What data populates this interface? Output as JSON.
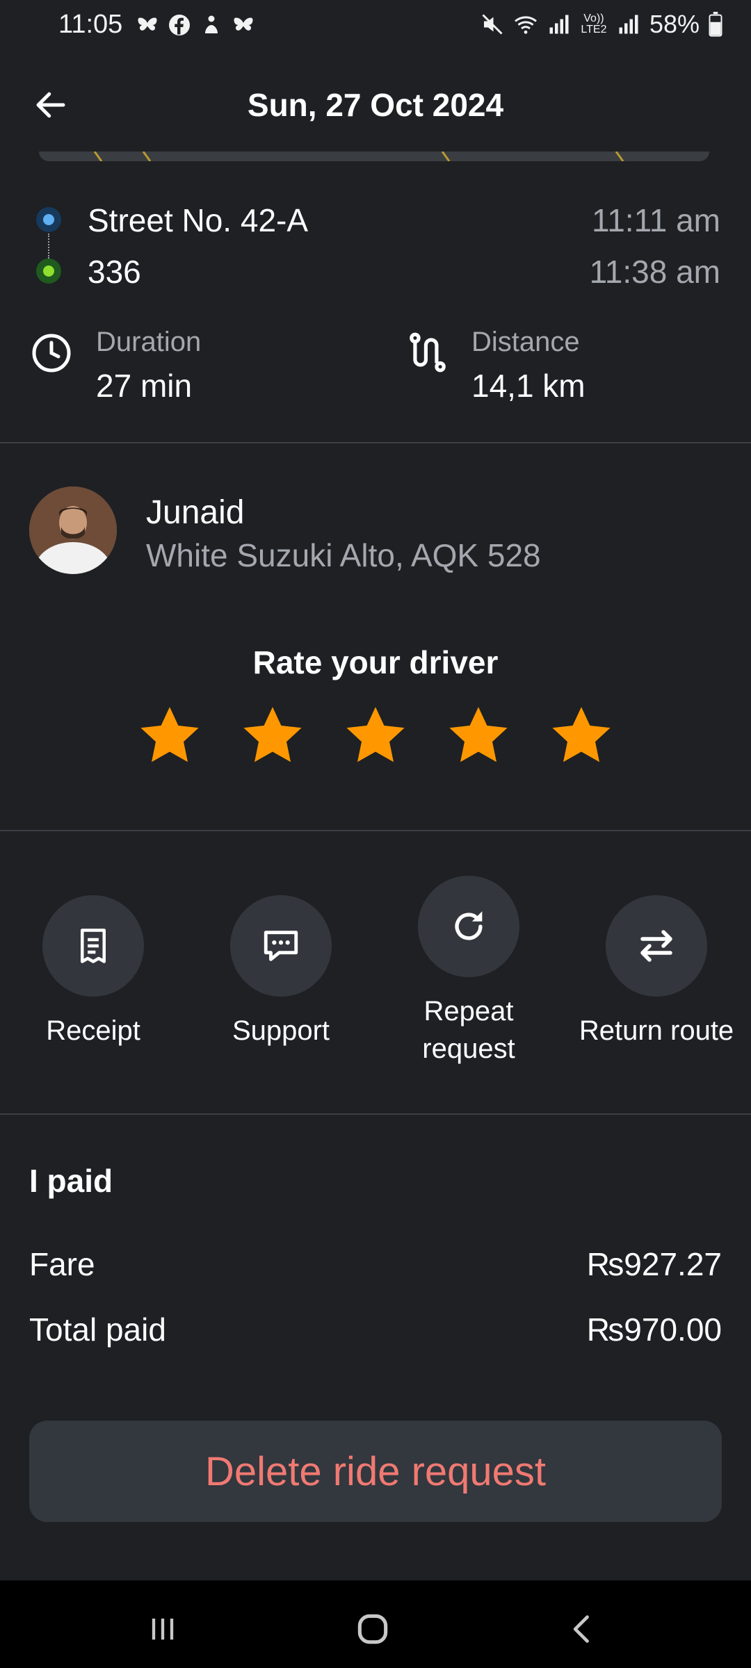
{
  "status_bar": {
    "time": "11:05",
    "battery": "58%",
    "network_label": "Vo)) LTE2"
  },
  "header": {
    "title": "Sun, 27 Oct 2024",
    "back_icon": "arrow-left-icon"
  },
  "route": {
    "pickup": "Street No. 42-A",
    "pickup_time": "11:11 am",
    "dropoff": "336",
    "dropoff_time": "11:38 am"
  },
  "stats": {
    "duration_label": "Duration",
    "duration_value": "27 min",
    "distance_label": "Distance",
    "distance_value": "14,1 km"
  },
  "driver": {
    "name": "Junaid",
    "car": "White Suzuki Alto, AQK 528",
    "rate_title": "Rate your driver",
    "stars_total": 5,
    "star_color": "#ff9800"
  },
  "actions": [
    {
      "label": "Receipt",
      "icon": "receipt-icon"
    },
    {
      "label": "Support",
      "icon": "chat-icon"
    },
    {
      "label": "Repeat request",
      "icon": "refresh-icon"
    },
    {
      "label": "Return route",
      "icon": "swap-arrows-icon"
    }
  ],
  "payment": {
    "title": "I paid",
    "fare_label": "Fare",
    "fare_value": "₨927.27",
    "total_label": "Total paid",
    "total_value": "₨970.00"
  },
  "delete_button": "Delete ride request",
  "colors": {
    "background": "#1e2024",
    "accent_delete": "#f07a72",
    "pickup_dot": "#5fb0f2",
    "dropoff_dot": "#8fe02e"
  }
}
